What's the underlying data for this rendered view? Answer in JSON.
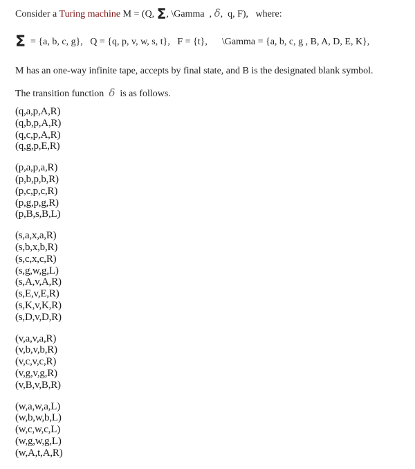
{
  "intro": {
    "prefix": "Consider a ",
    "highlight": "Turing machine",
    "m_open": " M = (Q, ",
    "sigma_symbol": "Σ",
    "after_sigma": ", \\Gamma  , ",
    "delta_symbol": "δ",
    "tail": ",  q, F),   where:"
  },
  "definitions": {
    "sigma_symbol": "Σ",
    "sigma_set": "  = {a, b, c, g},   Q = {q, p, v, w, s, t},   F = {t},      \\Gamma = {a, b, c, g , B, A, D, E, K},"
  },
  "description": "M has an one-way infinite tape, accepts by final state, and B is the designated blank symbol.",
  "transition_intro": {
    "before": "The transition function  ",
    "delta_symbol": "δ",
    "after": "  is as follows."
  },
  "transition_groups": [
    [
      "(q,a,p,A,R)",
      "(q,b,p,A,R)",
      "(q,c,p,A,R)",
      "(q,g,p,E,R)"
    ],
    [
      "(p,a,p,a,R)",
      "(p,b,p,b,R)",
      "(p,c,p,c,R)",
      "(p,g,p,g,R)",
      "(p,B,s,B,L)"
    ],
    [
      "(s,a,x,a,R)",
      "(s,b,x,b,R)",
      "(s,c,x,c,R)",
      "(s,g,w,g,L)",
      "(s,A,v,A,R)",
      "(s,E,v,E,R)",
      "(s,K,v,K,R)",
      "(s,D,v,D,R)"
    ],
    [
      "(v,a,v,a,R)",
      "(v,b,v,b,R)",
      "(v,c,v,c,R)",
      "(v,g,v,g,R)",
      "(v,B,v,B,R)"
    ],
    [
      "(w,a,w,a,L)",
      "(w,b,w,b,L)",
      "(w,c,w,c,L)",
      "(w,g,w,g,L)",
      "(w,A,t,A,R)"
    ]
  ],
  "colors": {
    "text": "#222222",
    "highlight": "#7a1010"
  }
}
